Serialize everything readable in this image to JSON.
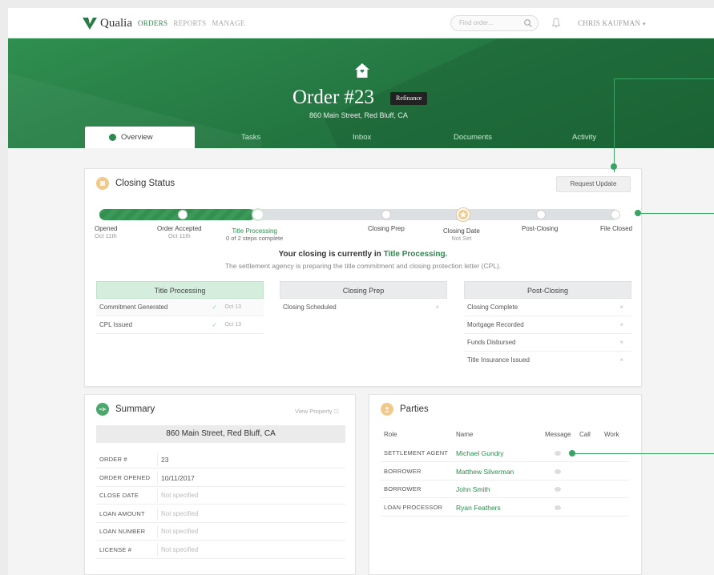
{
  "nav": {
    "brand": "Qualia",
    "links": [
      "ORDERS",
      "REPORTS",
      "MANAGE"
    ],
    "search_placeholder": "Find order...",
    "user": "CHRIS KAUFMAN"
  },
  "hero": {
    "title": "Order #23",
    "badge": "Refinance",
    "address": "860 Main Street, Red Bluff, CA"
  },
  "tabs": [
    "Overview",
    "Tasks",
    "Inbox",
    "Documents",
    "Activity"
  ],
  "closing": {
    "title": "Closing Status",
    "request_button": "Request Update",
    "progress_fraction": 0.3,
    "stages": [
      {
        "label": "Opened",
        "sub": "Oct 11th"
      },
      {
        "label": "Order Accepted",
        "sub": "Oct 11th"
      },
      {
        "label": "Title Processing",
        "sub": "0 of 2 steps complete"
      },
      {
        "label": "Closing Prep",
        "sub": ""
      },
      {
        "label": "Closing Date",
        "sub": "Not Set"
      },
      {
        "label": "Post-Closing",
        "sub": ""
      },
      {
        "label": "File Closed",
        "sub": ""
      }
    ],
    "message_prefix": "Your closing is currently in",
    "message_stage": "Title Processing.",
    "description": "The settlement agency is preparing the title commitment and closing protection letter (CPL).",
    "phases": [
      {
        "title": "Title Processing",
        "tasks": [
          {
            "name": "Commitment Generated",
            "date": "Oct 13"
          },
          {
            "name": "CPL Issued",
            "date": "Oct 13"
          }
        ]
      },
      {
        "title": "Closing Prep",
        "tasks": [
          {
            "name": "Closing Scheduled"
          }
        ]
      },
      {
        "title": "Post-Closing",
        "tasks": [
          {
            "name": "Closing Complete"
          },
          {
            "name": "Mortgage Recorded"
          },
          {
            "name": "Funds Disbursed"
          },
          {
            "name": "Title Insurance Issued"
          }
        ]
      }
    ]
  },
  "summary": {
    "title": "Summary",
    "view_property": "View Property",
    "address": "860 Main Street, Red Bluff, CA",
    "rows": [
      {
        "key": "ORDER #",
        "value": "23"
      },
      {
        "key": "ORDER OPENED",
        "value": "10/11/2017"
      },
      {
        "key": "CLOSE DATE",
        "value": "Not specified"
      },
      {
        "key": "LOAN AMOUNT",
        "value": "Not specified"
      },
      {
        "key": "LOAN NUMBER",
        "value": "Not specified"
      },
      {
        "key": "LICENSE #",
        "value": "Not specified"
      }
    ]
  },
  "parties": {
    "title": "Parties",
    "headers": [
      "Role",
      "Name",
      "Message",
      "Call",
      "Work"
    ],
    "rows": [
      {
        "role": "SETTLEMENT AGENT",
        "name": "Michael Gundry"
      },
      {
        "role": "BORROWER",
        "name": "Matthew Silverman"
      },
      {
        "role": "BORROWER",
        "name": "John Smith"
      },
      {
        "role": "LOAN PROCESSOR",
        "name": "Ryan Feathers"
      }
    ]
  },
  "colors": {
    "brand_green": "#2d8a4e",
    "accent_orange": "#f2c98a"
  }
}
